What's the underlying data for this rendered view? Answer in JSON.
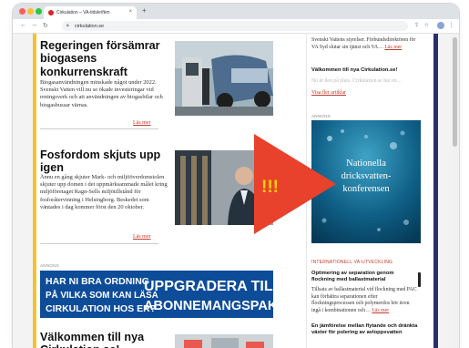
{
  "browser": {
    "tab_title": "Cirkulation – VA-tidskriften",
    "url": "cirkulation.se",
    "close_glyph": "×",
    "newtab_glyph": "+",
    "back_glyph": "←",
    "forward_glyph": "→",
    "reload_glyph": "↻",
    "window_controls": [
      "#ff5f57",
      "#febc2e",
      "#28c840"
    ]
  },
  "articles": [
    {
      "title": "Regeringen försämrar biogasens konkurrenskraft",
      "body": "Biogasanvändningen minskade något under 2022. Svenskt Vatten vill nu se ökade investeringar vid reningsverk och att användningen av biogasbilar och biogasbussar värnas.",
      "read_more": "Läs mer"
    },
    {
      "title": "Fosfordom skjuts upp igen",
      "body": "Ännu en gång skjuter Mark- och miljööverdomstolen skjuter upp domen i det uppmärksammade målet kring miljöföretaget Ragn-Sells miljötillstånd för fosforåtervinning i Helsingborg. Beskedet som väntades i dag kommer först den 20 oktober.",
      "read_more": "Läs mer"
    },
    {
      "title": "Välkommen till nya Cirkulation.se!"
    }
  ],
  "ad_label": "ANNONS",
  "banner": {
    "left_lines": [
      "HAR NI BRA ORDNING",
      "PÅ VILKA SOM KAN LÄSA",
      "CIRKULATION HOS ER?"
    ],
    "right_lines": [
      "UPPGRADERA TILL",
      "ABONNEMANGSPAKET"
    ]
  },
  "sidebar": {
    "top_text": "Svenskt Vattens styrelser. Förbundsdirektören för VA Syd slutar sin tjänst och VA…",
    "top_link": "Läs mer",
    "welcome": "Välkommen till nya Cirkulation.se!",
    "welcome_faded": "Nu är den på plats. Cirkulation.se har en…",
    "more_articles": "Visa fler artiklar",
    "ad_label": "ANNONS",
    "conference": [
      "Nationella",
      "dricksvatten-",
      "konferensen"
    ],
    "category": "INTERNATIONELL VA-UTVECKLING",
    "item1_title": "Optimering av separation genom flockning med ballastmaterial",
    "item1_body": "Tillsats av ballastmaterial vid flockning med PAC kan förbättra separationen efter flockningsprocessen och polymerdos hör även ingå i kombinationen och…",
    "item1_link": "Läs mer",
    "item2_title": "En jämförelse mellan flytande och dränkta växter för polering av avloppsvatten"
  },
  "overlay": {
    "text": "!!!",
    "arrow_color": "#e8412c",
    "text_color": "#ffd200"
  }
}
